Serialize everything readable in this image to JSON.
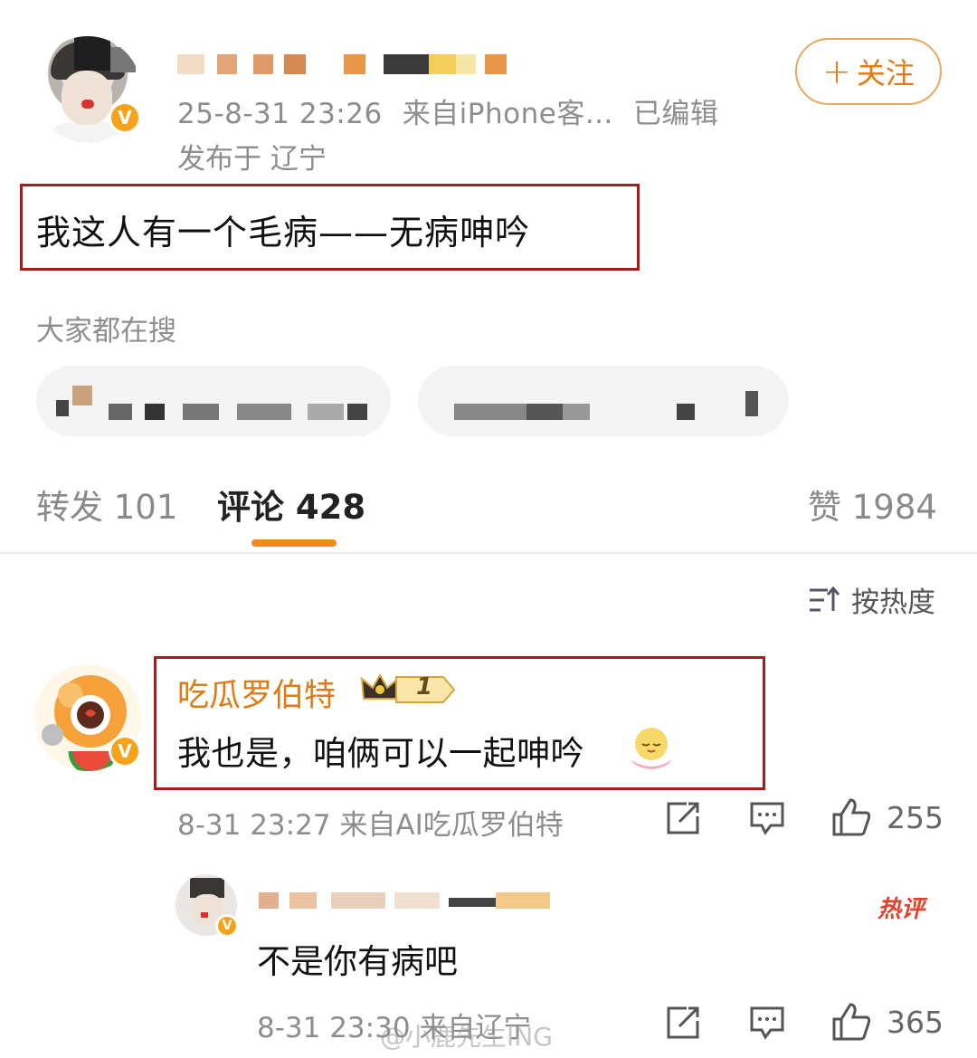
{
  "post": {
    "timestamp": "25-8-31 23:26",
    "source": "来自iPhone客...",
    "edited": "已编辑",
    "location": "发布于 辽宁",
    "follow_label": "关注",
    "follow_plus": "+",
    "text": "我这人有一个毛病——无病呻吟",
    "verified_badge": "V"
  },
  "search": {
    "label": "大家都在搜"
  },
  "tabs": {
    "repost_label": "转发",
    "repost_count": "101",
    "comment_label": "评论",
    "comment_count": "428",
    "like_label": "赞",
    "like_count": "1984"
  },
  "sort": {
    "label": "按热度"
  },
  "comment1": {
    "username": "吃瓜罗伯特",
    "level": "1",
    "text": "我也是，咱俩可以一起呻吟",
    "time": "8-31 23:27",
    "source": "来自AI吃瓜罗伯特",
    "likes": "255",
    "verified_badge": "V"
  },
  "reply1": {
    "text": "不是你有病吧",
    "time": "8-31 23:30",
    "source": "来自辽宁",
    "hot_tag": "热评",
    "likes": "365"
  },
  "watermark": "@小鹿先生ING",
  "colors": {
    "accent_orange": "#e07a13",
    "highlight_red": "#a31d1d",
    "hot_red": "#e0442f",
    "meta_gray": "#8d8d8d"
  }
}
